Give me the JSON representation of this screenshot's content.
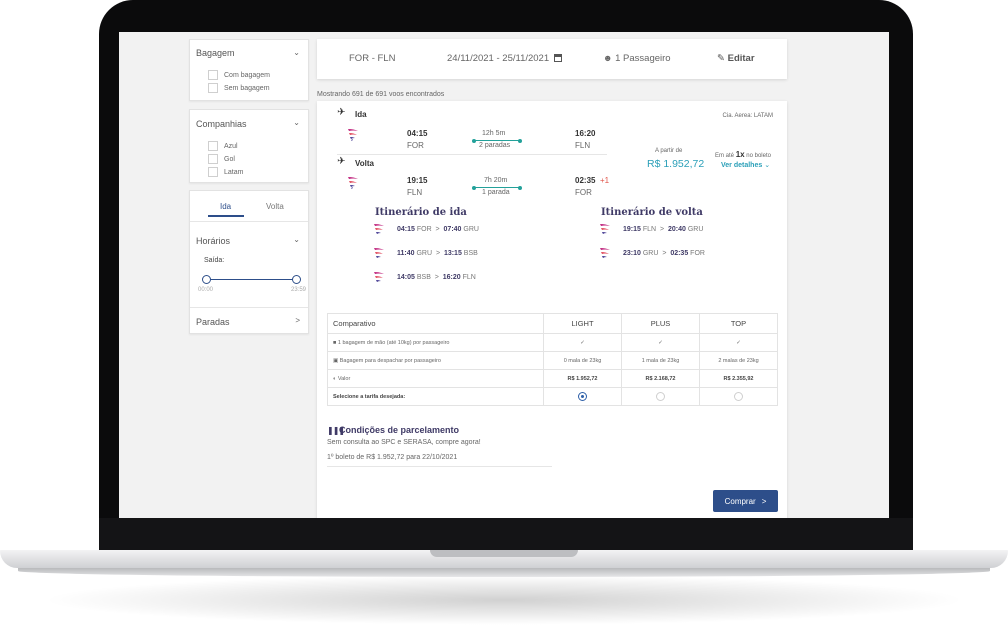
{
  "sidebar": {
    "baggage": {
      "title": "Bagagem",
      "options": [
        "Com bagagem",
        "Sem bagagem"
      ]
    },
    "airlines": {
      "title": "Companhias",
      "options": [
        "Azul",
        "Gol",
        "Latam"
      ]
    },
    "times_panel": {
      "tabs": [
        "Ida",
        "Volta"
      ],
      "active_tab": "Ida",
      "hours_title": "Horários",
      "departure_label": "Saída:",
      "range_min": "00:00",
      "range_max": "23:59"
    },
    "stops_title": "Paradas"
  },
  "search": {
    "route": "FOR - FLN",
    "dates": "24/11/2021 - 25/11/2021",
    "passengers": "1 Passageiro",
    "edit_label": "Editar"
  },
  "results_count": "Mostrando 691 de 691 voos encontrados",
  "flight": {
    "airline_label": "Cia. Aerea: LATAM",
    "outbound": {
      "label": "Ida",
      "dep_time": "04:15",
      "dep_airport": "FOR",
      "duration": "12h 5m",
      "stops": "2 paradas",
      "arr_time": "16:20",
      "arr_airport": "FLN"
    },
    "inbound": {
      "label": "Volta",
      "dep_time": "19:15",
      "dep_airport": "FLN",
      "duration": "7h 20m",
      "stops": "1 parada",
      "arr_time": "02:35",
      "arr_day_offset": "+1",
      "arr_airport": "FOR"
    },
    "price": {
      "from_label": "A partir de",
      "value": "R$ 1.952,72",
      "installments_prefix": "Em até",
      "installments_bold": "1x",
      "installments_suffix": "no boleto",
      "details_link": "Ver detalhes"
    }
  },
  "itinerary": {
    "outbound_title": "Itinerário de ida",
    "inbound_title": "Itinerário de volta",
    "outbound_legs": [
      {
        "dep_time": "04:15",
        "dep": "FOR",
        "arr_time": "07:40",
        "arr": "GRU"
      },
      {
        "dep_time": "11:40",
        "dep": "GRU",
        "arr_time": "13:15",
        "arr": "BSB"
      },
      {
        "dep_time": "14:05",
        "dep": "BSB",
        "arr_time": "16:20",
        "arr": "FLN"
      }
    ],
    "inbound_legs": [
      {
        "dep_time": "19:15",
        "dep": "FLN",
        "arr_time": "20:40",
        "arr": "GRU"
      },
      {
        "dep_time": "23:10",
        "dep": "GRU",
        "arr_time": "02:35",
        "arr": "FOR"
      }
    ]
  },
  "fares": {
    "header": [
      "Comparativo",
      "LIGHT",
      "PLUS",
      "TOP"
    ],
    "rows": [
      {
        "label": "1 bagagem de mão (até 10kg) por passageiro",
        "values": [
          "✓",
          "✓",
          "✓"
        ]
      },
      {
        "label": "Bagagem para despachar por passageiro",
        "values": [
          "0 mala de 23kg",
          "1 mala de 23kg",
          "2 malas de 23kg"
        ]
      },
      {
        "label": "Valor",
        "values": [
          "R$ 1.952,72",
          "R$ 2.168,72",
          "R$ 2.355,92"
        ]
      }
    ],
    "select_label": "Selecione a tarifa desejada:",
    "selected_index": 0
  },
  "installments": {
    "title": "Condições de parcelamento",
    "line1": "Sem consulta ao SPC e SERASA, compre agora!",
    "line2": "1º boleto de R$ 1.952,72 para 22/10/2021"
  },
  "buy_button": "Comprar",
  "colors": {
    "accent_blue": "#2d4e8a",
    "teal": "#23a19a",
    "price_teal": "#2a9fb8",
    "latam_magenta": "#c0267e",
    "latam_indigo": "#3a2f8c"
  }
}
